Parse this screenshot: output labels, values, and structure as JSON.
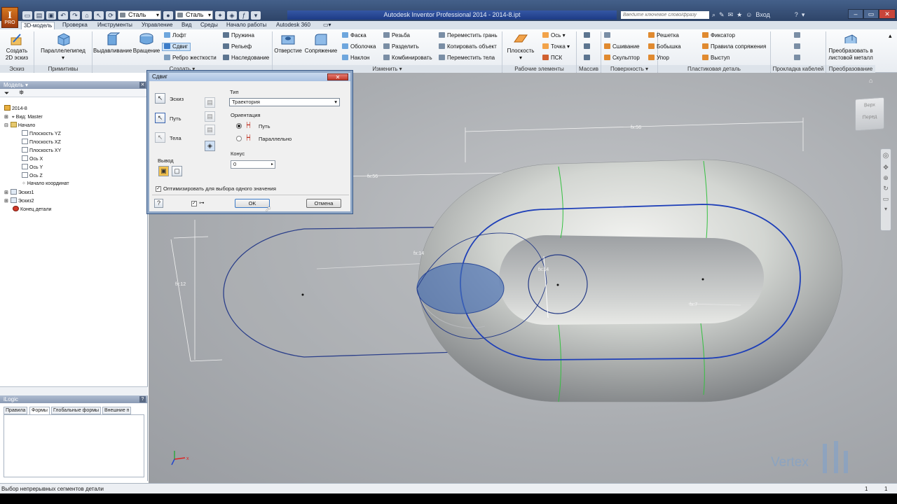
{
  "window": {
    "title": "Autodesk Inventor Professional 2014 - 2014-8.ipt",
    "app_logo": "I",
    "app_logo_sub": "PRO",
    "search_placeholder": "Введите ключевое слово/фразу",
    "sign_in": "Вход",
    "quick_access": {
      "material": "Сталь",
      "appearance": "Сталь"
    }
  },
  "tabs": [
    "3D-модель",
    "Проверка",
    "Инструменты",
    "Управление",
    "Вид",
    "Среды",
    "Начало работы",
    "Autodesk 360"
  ],
  "ribbon": {
    "sketch": {
      "create_sketch": "Создать",
      "create_sketch2": "2D эскиз",
      "panel": "Эскиз"
    },
    "primitives": {
      "box": "Параллелепипед",
      "panel": "Примитивы"
    },
    "create": {
      "extrude": "Выдавливание",
      "revolve": "Вращение",
      "loft": "Лофт",
      "sweep": "Сдвиг",
      "rib": "Ребро жесткости",
      "coil": "Пружина",
      "emboss": "Рельеф",
      "derive": "Наследование",
      "panel": "Создать"
    },
    "modify": {
      "hole": "Отверстие",
      "fillet": "Сопряжение",
      "chamfer": "Фаска",
      "shell": "Оболочка",
      "draft": "Наклон",
      "thread": "Резьба",
      "split": "Разделить",
      "combine": "Комбинировать",
      "move_face": "Переместить грань",
      "copy_object": "Копировать объект",
      "move_bodies": "Переместить тела",
      "panel": "Изменить"
    },
    "work_features": {
      "plane": "Плоскость",
      "axis": "Ось",
      "point": "Точка",
      "ucs": "ПСК",
      "panel": "Рабочие элементы"
    },
    "pattern": {
      "panel": "Массив"
    },
    "surface": {
      "stitch": "Сшивание",
      "sculpt": "Скульптор",
      "panel": "Поверхность"
    },
    "plastic": {
      "grill": "Решетка",
      "boss": "Бобышка",
      "rest": "Упор",
      "snap_fit": "Фиксатор",
      "rule_fillet": "Правила сопряжения",
      "lip": "Выступ",
      "panel": "Пластиковая деталь"
    },
    "harness": {
      "panel": "Прокладка кабелей"
    },
    "convert": {
      "label1": "Преобразовать в",
      "label2": "листовой металл",
      "panel": "Преобразование"
    }
  },
  "browser": {
    "title": "Модель",
    "tree": [
      {
        "label": "2014-8",
        "level": 0
      },
      {
        "label": "Вид: Master",
        "level": 1
      },
      {
        "label": "Начало",
        "level": 1
      },
      {
        "label": "Плоскость YZ",
        "level": 2
      },
      {
        "label": "Плоскость XZ",
        "level": 2
      },
      {
        "label": "Плоскость XY",
        "level": 2
      },
      {
        "label": "Ось X",
        "level": 2
      },
      {
        "label": "Ось Y",
        "level": 2
      },
      {
        "label": "Ось Z",
        "level": 2
      },
      {
        "label": "Начало координат",
        "level": 2
      },
      {
        "label": "Эскиз1",
        "level": 1
      },
      {
        "label": "Эскиз2",
        "level": 1
      },
      {
        "label": "Конец детали",
        "level": 1
      }
    ]
  },
  "ilogic": {
    "title": "iLogic",
    "tabs": [
      "Правила",
      "Формы",
      "Глобальные формы",
      "Внешние п"
    ]
  },
  "dialog": {
    "title": "Сдвиг",
    "profile": "Эскиз",
    "path": "Путь",
    "solids": "Тела",
    "output": "Вывод",
    "type_label": "Тип",
    "type_value": "Траектория",
    "orientation_label": "Ориентация",
    "orient_path": "Путь",
    "orient_parallel": "Параллельно",
    "taper_label": "Конус",
    "taper_value": "0",
    "optimize": "Оптимизировать для выбора одного значения",
    "ok": "OK",
    "cancel": "Отмена"
  },
  "viewcube": {
    "top": "Верх",
    "front": "Перед"
  },
  "dimensions": {
    "d1": "fx:56",
    "d2": "fx:56",
    "d3": "fx:12",
    "d4": "fx:14",
    "d5": "fx:14",
    "d6": "fx:7"
  },
  "watermark": "Vertex",
  "status": {
    "message": "Выбор непрерывных сегментов детали",
    "count1": "1",
    "count2": "1"
  }
}
